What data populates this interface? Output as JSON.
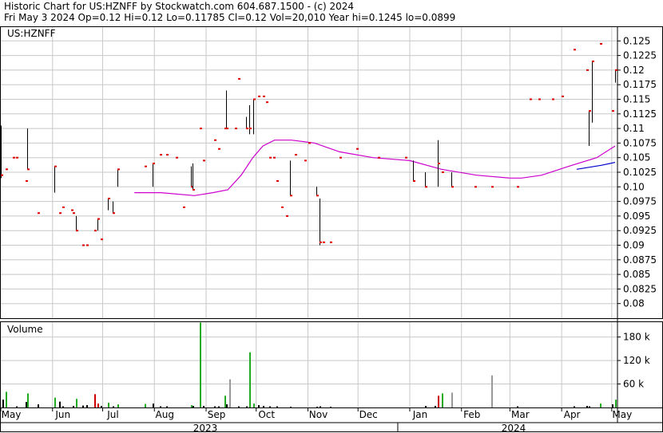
{
  "header": {
    "line1": "Historic Chart for US:HZNFF by Stockwatch.com 604.687.1500 - (c) 2024",
    "line2": "Fri May  3 2024  Op=0.12  Hi=0.12  Lo=0.11785  Cl=0.12  Vol=20,010  Year hi=0.1245  lo=0.0899"
  },
  "chart_data": {
    "type": "ohlc",
    "symbol_label": "US:HZNFF",
    "volume_label": "Volume",
    "price_axis": {
      "min": 0.0775,
      "max": 0.1275,
      "ticks": [
        "0.125",
        "0.1225",
        "0.12",
        "0.1175",
        "0.115",
        "0.1125",
        "0.11",
        "0.1075",
        "0.105",
        "0.1025",
        "0.10",
        "0.0975",
        "0.095",
        "0.0925",
        "0.09",
        "0.0875",
        "0.085",
        "0.0825",
        "0.08"
      ]
    },
    "volume_axis": {
      "min": 0,
      "max": 220000,
      "ticks": [
        {
          "value": 180000,
          "label": "180 k"
        },
        {
          "value": 120000,
          "label": "120 k"
        },
        {
          "value": 60000,
          "label": "60 k"
        }
      ]
    },
    "x_axis": {
      "start": "2023-05-01",
      "end": "2024-05-03",
      "months": [
        "May",
        "Jun",
        "Jul",
        "Aug",
        "Sep",
        "Oct",
        "Nov",
        "Dec",
        "Jan",
        "Feb",
        "Mar",
        "Apr",
        "May"
      ],
      "years": [
        "2023",
        "2024"
      ]
    },
    "bars": [
      {
        "date": "2023-05-01",
        "high": 0.1105,
        "low": 0.1015,
        "close": 0.102
      },
      {
        "date": "2023-05-04",
        "high": 0.103,
        "low": 0.103,
        "close": 0.103
      },
      {
        "date": "2023-05-08",
        "high": 0.105,
        "low": 0.105,
        "close": 0.105
      },
      {
        "date": "2023-05-10",
        "high": 0.105,
        "low": 0.105,
        "close": 0.105
      },
      {
        "date": "2023-05-16",
        "high": 0.101,
        "low": 0.101,
        "close": 0.101
      },
      {
        "date": "2023-05-17",
        "high": 0.11,
        "low": 0.103,
        "close": 0.103
      },
      {
        "date": "2023-05-23",
        "high": 0.0955,
        "low": 0.0955,
        "close": 0.0955
      },
      {
        "date": "2023-06-02",
        "high": 0.1035,
        "low": 0.099,
        "close": 0.1035
      },
      {
        "date": "2023-06-05",
        "high": 0.0955,
        "low": 0.0955,
        "close": 0.0955
      },
      {
        "date": "2023-06-07",
        "high": 0.0965,
        "low": 0.0965,
        "close": 0.0965
      },
      {
        "date": "2023-06-12",
        "high": 0.096,
        "low": 0.096,
        "close": 0.096
      },
      {
        "date": "2023-06-13",
        "high": 0.0955,
        "low": 0.0955,
        "close": 0.0955
      },
      {
        "date": "2023-06-15",
        "high": 0.095,
        "low": 0.0925,
        "close": 0.0925
      },
      {
        "date": "2023-06-19",
        "high": 0.09,
        "low": 0.09,
        "close": 0.09
      },
      {
        "date": "2023-06-21",
        "high": 0.09,
        "low": 0.09,
        "close": 0.09
      },
      {
        "date": "2023-06-26",
        "high": 0.0925,
        "low": 0.0925,
        "close": 0.0925
      },
      {
        "date": "2023-06-28",
        "high": 0.0945,
        "low": 0.0925,
        "close": 0.0945
      },
      {
        "date": "2023-06-30",
        "high": 0.091,
        "low": 0.091,
        "close": 0.091
      },
      {
        "date": "2023-07-04",
        "high": 0.098,
        "low": 0.096,
        "close": 0.098
      },
      {
        "date": "2023-07-07",
        "high": 0.0975,
        "low": 0.0955,
        "close": 0.0955
      },
      {
        "date": "2023-07-10",
        "high": 0.103,
        "low": 0.1,
        "close": 0.103
      },
      {
        "date": "2023-07-26",
        "high": 0.1035,
        "low": 0.1035,
        "close": 0.1035
      },
      {
        "date": "2023-07-31",
        "high": 0.104,
        "low": 0.1,
        "close": 0.104
      },
      {
        "date": "2023-08-04",
        "high": 0.1055,
        "low": 0.1055,
        "close": 0.1055
      },
      {
        "date": "2023-08-08",
        "high": 0.1055,
        "low": 0.1055,
        "close": 0.1055
      },
      {
        "date": "2023-08-14",
        "high": 0.105,
        "low": 0.105,
        "close": 0.105
      },
      {
        "date": "2023-08-18",
        "high": 0.0965,
        "low": 0.0965,
        "close": 0.0965
      },
      {
        "date": "2023-08-23",
        "high": 0.1035,
        "low": 0.1,
        "close": 0.1
      },
      {
        "date": "2023-08-24",
        "high": 0.104,
        "low": 0.0995,
        "close": 0.0995
      },
      {
        "date": "2023-08-28",
        "high": 0.11,
        "low": 0.11,
        "close": 0.11
      },
      {
        "date": "2023-08-30",
        "high": 0.1045,
        "low": 0.1045,
        "close": 0.1045
      },
      {
        "date": "2023-09-06",
        "high": 0.108,
        "low": 0.108,
        "close": 0.108
      },
      {
        "date": "2023-09-08",
        "high": 0.1065,
        "low": 0.1065,
        "close": 0.1065
      },
      {
        "date": "2023-09-12",
        "high": 0.11,
        "low": 0.11,
        "close": 0.11
      },
      {
        "date": "2023-09-13",
        "high": 0.1165,
        "low": 0.11,
        "close": 0.11
      },
      {
        "date": "2023-09-18",
        "high": 0.11,
        "low": 0.11,
        "close": 0.11
      },
      {
        "date": "2023-09-20",
        "high": 0.1185,
        "low": 0.1185,
        "close": 0.1185
      },
      {
        "date": "2023-09-25",
        "high": 0.112,
        "low": 0.11,
        "close": 0.11
      },
      {
        "date": "2023-09-27",
        "high": 0.114,
        "low": 0.109,
        "close": 0.11
      },
      {
        "date": "2023-09-29",
        "high": 0.115,
        "low": 0.109,
        "close": 0.115
      },
      {
        "date": "2023-10-02",
        "high": 0.1155,
        "low": 0.1155,
        "close": 0.1155
      },
      {
        "date": "2023-10-05",
        "high": 0.1155,
        "low": 0.1155,
        "close": 0.1155
      },
      {
        "date": "2023-10-07",
        "high": 0.1145,
        "low": 0.1145,
        "close": 0.1145
      },
      {
        "date": "2023-10-09",
        "high": 0.105,
        "low": 0.105,
        "close": 0.105
      },
      {
        "date": "2023-10-11",
        "high": 0.105,
        "low": 0.105,
        "close": 0.105
      },
      {
        "date": "2023-10-13",
        "high": 0.101,
        "low": 0.101,
        "close": 0.101
      },
      {
        "date": "2023-10-16",
        "high": 0.0965,
        "low": 0.0965,
        "close": 0.0965
      },
      {
        "date": "2023-10-19",
        "high": 0.095,
        "low": 0.095,
        "close": 0.095
      },
      {
        "date": "2023-10-21",
        "high": 0.1045,
        "low": 0.0985,
        "close": 0.0985
      },
      {
        "date": "2023-10-24",
        "high": 0.1055,
        "low": 0.1055,
        "close": 0.1055
      },
      {
        "date": "2023-10-30",
        "high": 0.1045,
        "low": 0.1045,
        "close": 0.1045
      },
      {
        "date": "2023-11-01",
        "high": 0.1075,
        "low": 0.1075,
        "close": 0.1075
      },
      {
        "date": "2023-11-06",
        "high": 0.1,
        "low": 0.0985,
        "close": 0.0985
      },
      {
        "date": "2023-11-08",
        "high": 0.098,
        "low": 0.09,
        "close": 0.0905
      },
      {
        "date": "2023-11-10",
        "high": 0.0905,
        "low": 0.0905,
        "close": 0.0905
      },
      {
        "date": "2023-11-14",
        "high": 0.0905,
        "low": 0.0905,
        "close": 0.0905
      },
      {
        "date": "2023-11-20",
        "high": 0.105,
        "low": 0.105,
        "close": 0.105
      },
      {
        "date": "2023-11-30",
        "high": 0.1065,
        "low": 0.1065,
        "close": 0.1065
      },
      {
        "date": "2023-12-13",
        "high": 0.105,
        "low": 0.105,
        "close": 0.105
      },
      {
        "date": "2023-12-29",
        "high": 0.105,
        "low": 0.105,
        "close": 0.105
      },
      {
        "date": "2024-01-03",
        "high": 0.1045,
        "low": 0.101,
        "close": 0.101
      },
      {
        "date": "2024-01-10",
        "high": 0.1025,
        "low": 0.1,
        "close": 0.1
      },
      {
        "date": "2024-01-18",
        "high": 0.108,
        "low": 0.1,
        "close": 0.104
      },
      {
        "date": "2024-01-20",
        "high": 0.1025,
        "low": 0.1025,
        "close": 0.1025
      },
      {
        "date": "2024-01-26",
        "high": 0.1025,
        "low": 0.1,
        "close": 0.1
      },
      {
        "date": "2024-02-09",
        "high": 0.1,
        "low": 0.1,
        "close": 0.1
      },
      {
        "date": "2024-02-19",
        "high": 0.1,
        "low": 0.1,
        "close": 0.1
      },
      {
        "date": "2024-03-05",
        "high": 0.1,
        "low": 0.1,
        "close": 0.1
      },
      {
        "date": "2024-03-13",
        "high": 0.115,
        "low": 0.115,
        "close": 0.115
      },
      {
        "date": "2024-03-18",
        "high": 0.115,
        "low": 0.115,
        "close": 0.115
      },
      {
        "date": "2024-03-26",
        "high": 0.115,
        "low": 0.115,
        "close": 0.115
      },
      {
        "date": "2024-04-01",
        "high": 0.1155,
        "low": 0.1155,
        "close": 0.1155
      },
      {
        "date": "2024-04-08",
        "high": 0.1235,
        "low": 0.1235,
        "close": 0.1235
      },
      {
        "date": "2024-04-16",
        "high": 0.12,
        "low": 0.12,
        "close": 0.12
      },
      {
        "date": "2024-04-17",
        "high": 0.113,
        "low": 0.107,
        "close": 0.113
      },
      {
        "date": "2024-04-19",
        "high": 0.1215,
        "low": 0.111,
        "close": 0.1215
      },
      {
        "date": "2024-04-24",
        "high": 0.1245,
        "low": 0.1245,
        "close": 0.1245
      },
      {
        "date": "2024-05-01",
        "high": 0.113,
        "low": 0.113,
        "close": 0.113
      },
      {
        "date": "2024-05-03",
        "high": 0.12,
        "low": 0.11785,
        "close": 0.12
      }
    ],
    "moving_averages": [
      {
        "color": "#cc00cc",
        "points": [
          [
            "2023-07-20",
            0.099
          ],
          [
            "2023-08-05",
            0.099
          ],
          [
            "2023-08-25",
            0.0985
          ],
          [
            "2023-09-05",
            0.099
          ],
          [
            "2023-09-14",
            0.0995
          ],
          [
            "2023-09-22",
            0.102
          ],
          [
            "2023-09-29",
            0.105
          ],
          [
            "2023-10-05",
            0.107
          ],
          [
            "2023-10-12",
            0.108
          ],
          [
            "2023-10-22",
            0.108
          ],
          [
            "2023-11-05",
            0.1075
          ],
          [
            "2023-11-20",
            0.106
          ],
          [
            "2023-12-10",
            0.105
          ],
          [
            "2024-01-01",
            0.1045
          ],
          [
            "2024-01-20",
            0.103
          ],
          [
            "2024-02-10",
            0.102
          ],
          [
            "2024-03-01",
            0.1015
          ],
          [
            "2024-03-08",
            0.1015
          ],
          [
            "2024-03-20",
            0.102
          ],
          [
            "2024-04-05",
            0.1035
          ],
          [
            "2024-04-22",
            0.105
          ],
          [
            "2024-05-03",
            0.107
          ]
        ]
      },
      {
        "color": "#0000cc",
        "points": [
          [
            "2024-04-10",
            0.103
          ],
          [
            "2024-04-25",
            0.1037
          ],
          [
            "2024-05-03",
            0.1042
          ]
        ]
      }
    ],
    "volume": [
      {
        "date": "2023-05-02",
        "value": 20000,
        "dir": "none"
      },
      {
        "date": "2023-05-04",
        "value": 40000,
        "dir": "up"
      },
      {
        "date": "2023-05-10",
        "value": 3000,
        "dir": "none"
      },
      {
        "date": "2023-05-16",
        "value": 14000,
        "dir": "none"
      },
      {
        "date": "2023-05-17",
        "value": 36000,
        "dir": "up"
      },
      {
        "date": "2023-05-23",
        "value": 8000,
        "dir": "none"
      },
      {
        "date": "2023-06-02",
        "value": 25000,
        "dir": "up"
      },
      {
        "date": "2023-06-05",
        "value": 15000,
        "dir": "none"
      },
      {
        "date": "2023-06-07",
        "value": 3000,
        "dir": "none"
      },
      {
        "date": "2023-06-13",
        "value": 4000,
        "dir": "none"
      },
      {
        "date": "2023-06-15",
        "value": 22000,
        "dir": "up"
      },
      {
        "date": "2023-06-19",
        "value": 5000,
        "dir": "none"
      },
      {
        "date": "2023-06-21",
        "value": 6000,
        "dir": "none"
      },
      {
        "date": "2023-06-26",
        "value": 34000,
        "dir": "down"
      },
      {
        "date": "2023-06-28",
        "value": 10000,
        "dir": "down"
      },
      {
        "date": "2023-06-30",
        "value": 4000,
        "dir": "none"
      },
      {
        "date": "2023-07-04",
        "value": 12000,
        "dir": "up"
      },
      {
        "date": "2023-07-07",
        "value": 3000,
        "dir": "none"
      },
      {
        "date": "2023-07-10",
        "value": 8000,
        "dir": "up"
      },
      {
        "date": "2023-07-26",
        "value": 9000,
        "dir": "up"
      },
      {
        "date": "2023-07-31",
        "value": 10000,
        "dir": "none"
      },
      {
        "date": "2023-08-04",
        "value": 3000,
        "dir": "none"
      },
      {
        "date": "2023-08-08",
        "value": 3000,
        "dir": "none"
      },
      {
        "date": "2023-08-23",
        "value": 6000,
        "dir": "up"
      },
      {
        "date": "2023-08-24",
        "value": 4000,
        "dir": "none"
      },
      {
        "date": "2023-08-28",
        "value": 217000,
        "dir": "up"
      },
      {
        "date": "2023-08-30",
        "value": 4000,
        "dir": "none"
      },
      {
        "date": "2023-09-06",
        "value": 3000,
        "dir": "none"
      },
      {
        "date": "2023-09-08",
        "value": 3000,
        "dir": "none"
      },
      {
        "date": "2023-09-12",
        "value": 30000,
        "dir": "up"
      },
      {
        "date": "2023-09-13",
        "value": 8000,
        "dir": "none"
      },
      {
        "date": "2023-09-15",
        "value": 72000,
        "dir": "flat"
      },
      {
        "date": "2023-09-20",
        "value": 3000,
        "dir": "none"
      },
      {
        "date": "2023-09-25",
        "value": 3000,
        "dir": "none"
      },
      {
        "date": "2023-09-27",
        "value": 141000,
        "dir": "up"
      },
      {
        "date": "2023-09-29",
        "value": 10000,
        "dir": "up"
      },
      {
        "date": "2023-10-02",
        "value": 6000,
        "dir": "none"
      },
      {
        "date": "2023-10-05",
        "value": 4000,
        "dir": "none"
      },
      {
        "date": "2023-10-09",
        "value": 3000,
        "dir": "none"
      },
      {
        "date": "2023-10-13",
        "value": 3000,
        "dir": "none"
      },
      {
        "date": "2023-10-21",
        "value": 2000,
        "dir": "none"
      },
      {
        "date": "2023-11-06",
        "value": 2000,
        "dir": "none"
      },
      {
        "date": "2023-11-08",
        "value": 3000,
        "dir": "none"
      },
      {
        "date": "2023-11-14",
        "value": 2000,
        "dir": "none"
      },
      {
        "date": "2024-01-10",
        "value": 4000,
        "dir": "none"
      },
      {
        "date": "2024-01-16",
        "value": 4000,
        "dir": "none"
      },
      {
        "date": "2024-01-18",
        "value": 30000,
        "dir": "down"
      },
      {
        "date": "2024-01-20",
        "value": 36000,
        "dir": "up"
      },
      {
        "date": "2024-01-26",
        "value": 38000,
        "dir": "flat"
      },
      {
        "date": "2024-02-19",
        "value": 82000,
        "dir": "flat"
      },
      {
        "date": "2024-03-05",
        "value": 3000,
        "dir": "none"
      },
      {
        "date": "2024-04-08",
        "value": 3000,
        "dir": "none"
      },
      {
        "date": "2024-04-16",
        "value": 4000,
        "dir": "none"
      },
      {
        "date": "2024-04-17",
        "value": 3000,
        "dir": "none"
      },
      {
        "date": "2024-04-24",
        "value": 10000,
        "dir": "up"
      },
      {
        "date": "2024-05-01",
        "value": 8000,
        "dir": "none"
      },
      {
        "date": "2024-05-03",
        "value": 20010,
        "dir": "up"
      }
    ],
    "colors": {
      "tick_mark": "#dd0000",
      "range_bar": "#000000",
      "vol_up": "#22aa22",
      "vol_down": "#cc0000",
      "vol_flat": "#999999",
      "vol_none": "#000000",
      "grid": "#c8c8c8",
      "frame": "#000000"
    }
  }
}
